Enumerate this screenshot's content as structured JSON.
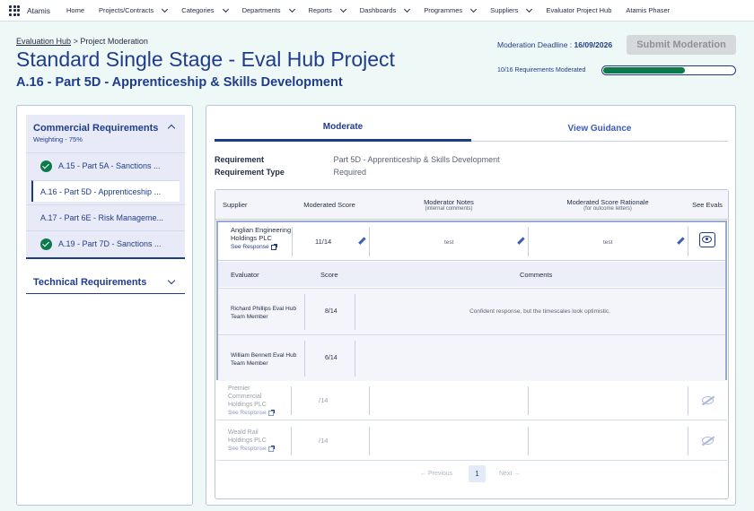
{
  "nav": {
    "brand": "Atamis",
    "items": [
      {
        "label": "Home",
        "dropdown": false
      },
      {
        "label": "Projects/Contracts",
        "dropdown": true
      },
      {
        "label": "Categories",
        "dropdown": true
      },
      {
        "label": "Departments",
        "dropdown": true
      },
      {
        "label": "Reports",
        "dropdown": true
      },
      {
        "label": "Dashboards",
        "dropdown": true
      },
      {
        "label": "Programmes",
        "dropdown": true
      },
      {
        "label": "Suppliers",
        "dropdown": true
      },
      {
        "label": "Evaluator Project Hub",
        "dropdown": false
      },
      {
        "label": "Atamis Phaser",
        "dropdown": false
      }
    ]
  },
  "header": {
    "breadcrumb_link": "Evaluation Hub",
    "breadcrumb_sep": ">",
    "breadcrumb_current": "Project Moderation",
    "title": "Standard Single Stage - Eval Hub Project",
    "subtitle": "A.16 - Part 5D - Apprenticeship & Skills Development",
    "deadline_label": "Moderation Deadline :",
    "deadline_value": "16/09/2026",
    "submit_label": "Submit Moderation",
    "progress_label": "10/16 Requirements Moderated",
    "progress_fraction": 0.625
  },
  "left": {
    "commercial_title": "Commercial Requirements",
    "commercial_weighting": "Weighting - 75%",
    "requirements": [
      {
        "label": "A.15 - Part 5A - Sanctions ...",
        "done": true,
        "active": false
      },
      {
        "label": "A.16 - Part 5D - Apprenticeship ...",
        "done": false,
        "active": true
      },
      {
        "label": "A.17 - Part 6E - Risk Manageme...",
        "done": false,
        "active": false
      },
      {
        "label": "A.19 - Part 7D - Sanctions ...",
        "done": true,
        "active": false
      }
    ],
    "technical_title": "Technical Requirements"
  },
  "main": {
    "tabs": [
      "Moderate",
      "View Guidance"
    ],
    "requirement_label": "Requirement",
    "requirement_value": "Part 5D - Apprenticeship & Skills Development",
    "type_label": "Requirement Type",
    "type_value": "Required",
    "table": {
      "headers": {
        "supplier": "Supplier",
        "score": "Moderated Score",
        "notes": "Moderator Notes",
        "notes_sub": "(internal comments)",
        "rationale": "Moderated Score Rationale",
        "rationale_sub": "(for outcome letters)",
        "evals": "See Evals"
      },
      "see_response": "See Response",
      "expanded_row": {
        "supplier": "Anglian Engineering Holdings PLC",
        "score": "11/14",
        "notes": "test",
        "rationale": "test"
      },
      "eval_headers": {
        "evaluator": "Evaluator",
        "score": "Score",
        "comments": "Comments"
      },
      "evaluations": [
        {
          "evaluator": "Richard Phillips Eval Hub Team Member",
          "score": "8/14",
          "comment": "Confident response, but the timescales look optimistic."
        },
        {
          "evaluator": "William Bennett Eval Hub Team Member",
          "score": "6/14",
          "comment": ""
        }
      ],
      "other_rows": [
        {
          "supplier": "Premier Commercial Holdings PLC",
          "score": "/14"
        },
        {
          "supplier": "Weald Rail Holdings PLC",
          "score": "/14"
        }
      ]
    },
    "pager": {
      "prev": "← Previous",
      "page": "1",
      "next": "Next →"
    }
  }
}
